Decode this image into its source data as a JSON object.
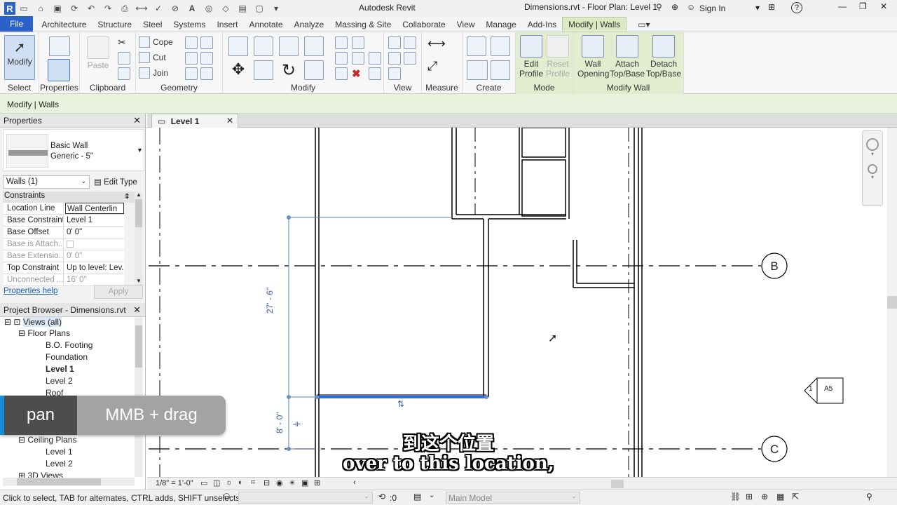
{
  "app": {
    "logo_letter": "R",
    "title": "Autodesk Revit",
    "document": "Dimensions.rvt - Floor Plan: Level 1",
    "sign_in": "Sign In",
    "help": "?"
  },
  "ribbon_tabs": [
    "File",
    "Architecture",
    "Structure",
    "Steel",
    "Systems",
    "Insert",
    "Annotate",
    "Analyze",
    "Massing & Site",
    "Collaborate",
    "View",
    "Manage",
    "Add-Ins",
    "Modify | Walls"
  ],
  "ribbon": {
    "select": {
      "label": "Select",
      "button": "Modify"
    },
    "properties": {
      "label": "Properties"
    },
    "clipboard": {
      "label": "Clipboard",
      "paste": "Paste"
    },
    "geometry": {
      "label": "Geometry",
      "cope": "Cope",
      "cut": "Cut",
      "join": "Join"
    },
    "modify": {
      "label": "Modify"
    },
    "view": {
      "label": "View"
    },
    "measure": {
      "label": "Measure"
    },
    "create": {
      "label": "Create"
    },
    "mode": {
      "label": "Mode",
      "edit_profile": "Edit Profile",
      "reset_profile": "Reset Profile"
    },
    "modify_wall": {
      "label": "Modify Wall",
      "wall_opening": "Wall Opening",
      "attach": "Attach Top/Base",
      "detach": "Detach Top/Base"
    }
  },
  "options_bar": {
    "context": "Modify | Walls"
  },
  "properties": {
    "title": "Properties",
    "type_line1": "Basic Wall",
    "type_line2": "Generic - 5\"",
    "selector": "Walls (1)",
    "edit_type": "Edit Type",
    "section": "Constraints",
    "rows": [
      {
        "k": "Location Line",
        "v": "Wall Centerlin"
      },
      {
        "k": "Base Constraint",
        "v": "Level 1"
      },
      {
        "k": "Base Offset",
        "v": "0'  0\""
      },
      {
        "k": "Base is Attach...",
        "v": ""
      },
      {
        "k": "Base Extensio...",
        "v": "0'  0\""
      },
      {
        "k": "Top Constraint",
        "v": "Up to level: Lev..."
      },
      {
        "k": "Unconnected ...",
        "v": "16'  0\""
      }
    ],
    "help": "Properties help",
    "apply": "Apply"
  },
  "browser": {
    "title": "Project Browser - Dimensions.rvt",
    "items": [
      "Views (all)",
      "Floor Plans",
      "B.O. Footing",
      "Foundation",
      "Level 1",
      "Level 2",
      "Roof",
      "Ceiling Plans",
      "Level 1",
      "Level 2",
      "3D Views"
    ]
  },
  "view": {
    "tab": "Level 1",
    "grid_b": "B",
    "grid_c": "C",
    "dim_upper": "27' - 6\"",
    "dim_lower": "8' - 0\"",
    "section_num": "1",
    "section_sheet": "A5"
  },
  "view_bar": {
    "scale": "1/8\" = 1'-0\""
  },
  "status": {
    "hint": "Click to select, TAB for alternates, CTRL adds, SHIFT unselects.",
    "count": ":0",
    "model": "Main Model"
  },
  "overlay": {
    "action": "pan",
    "shortcut": "MMB + drag"
  },
  "subtitles": {
    "zh": "到这个位置",
    "en": "over to this location,"
  }
}
